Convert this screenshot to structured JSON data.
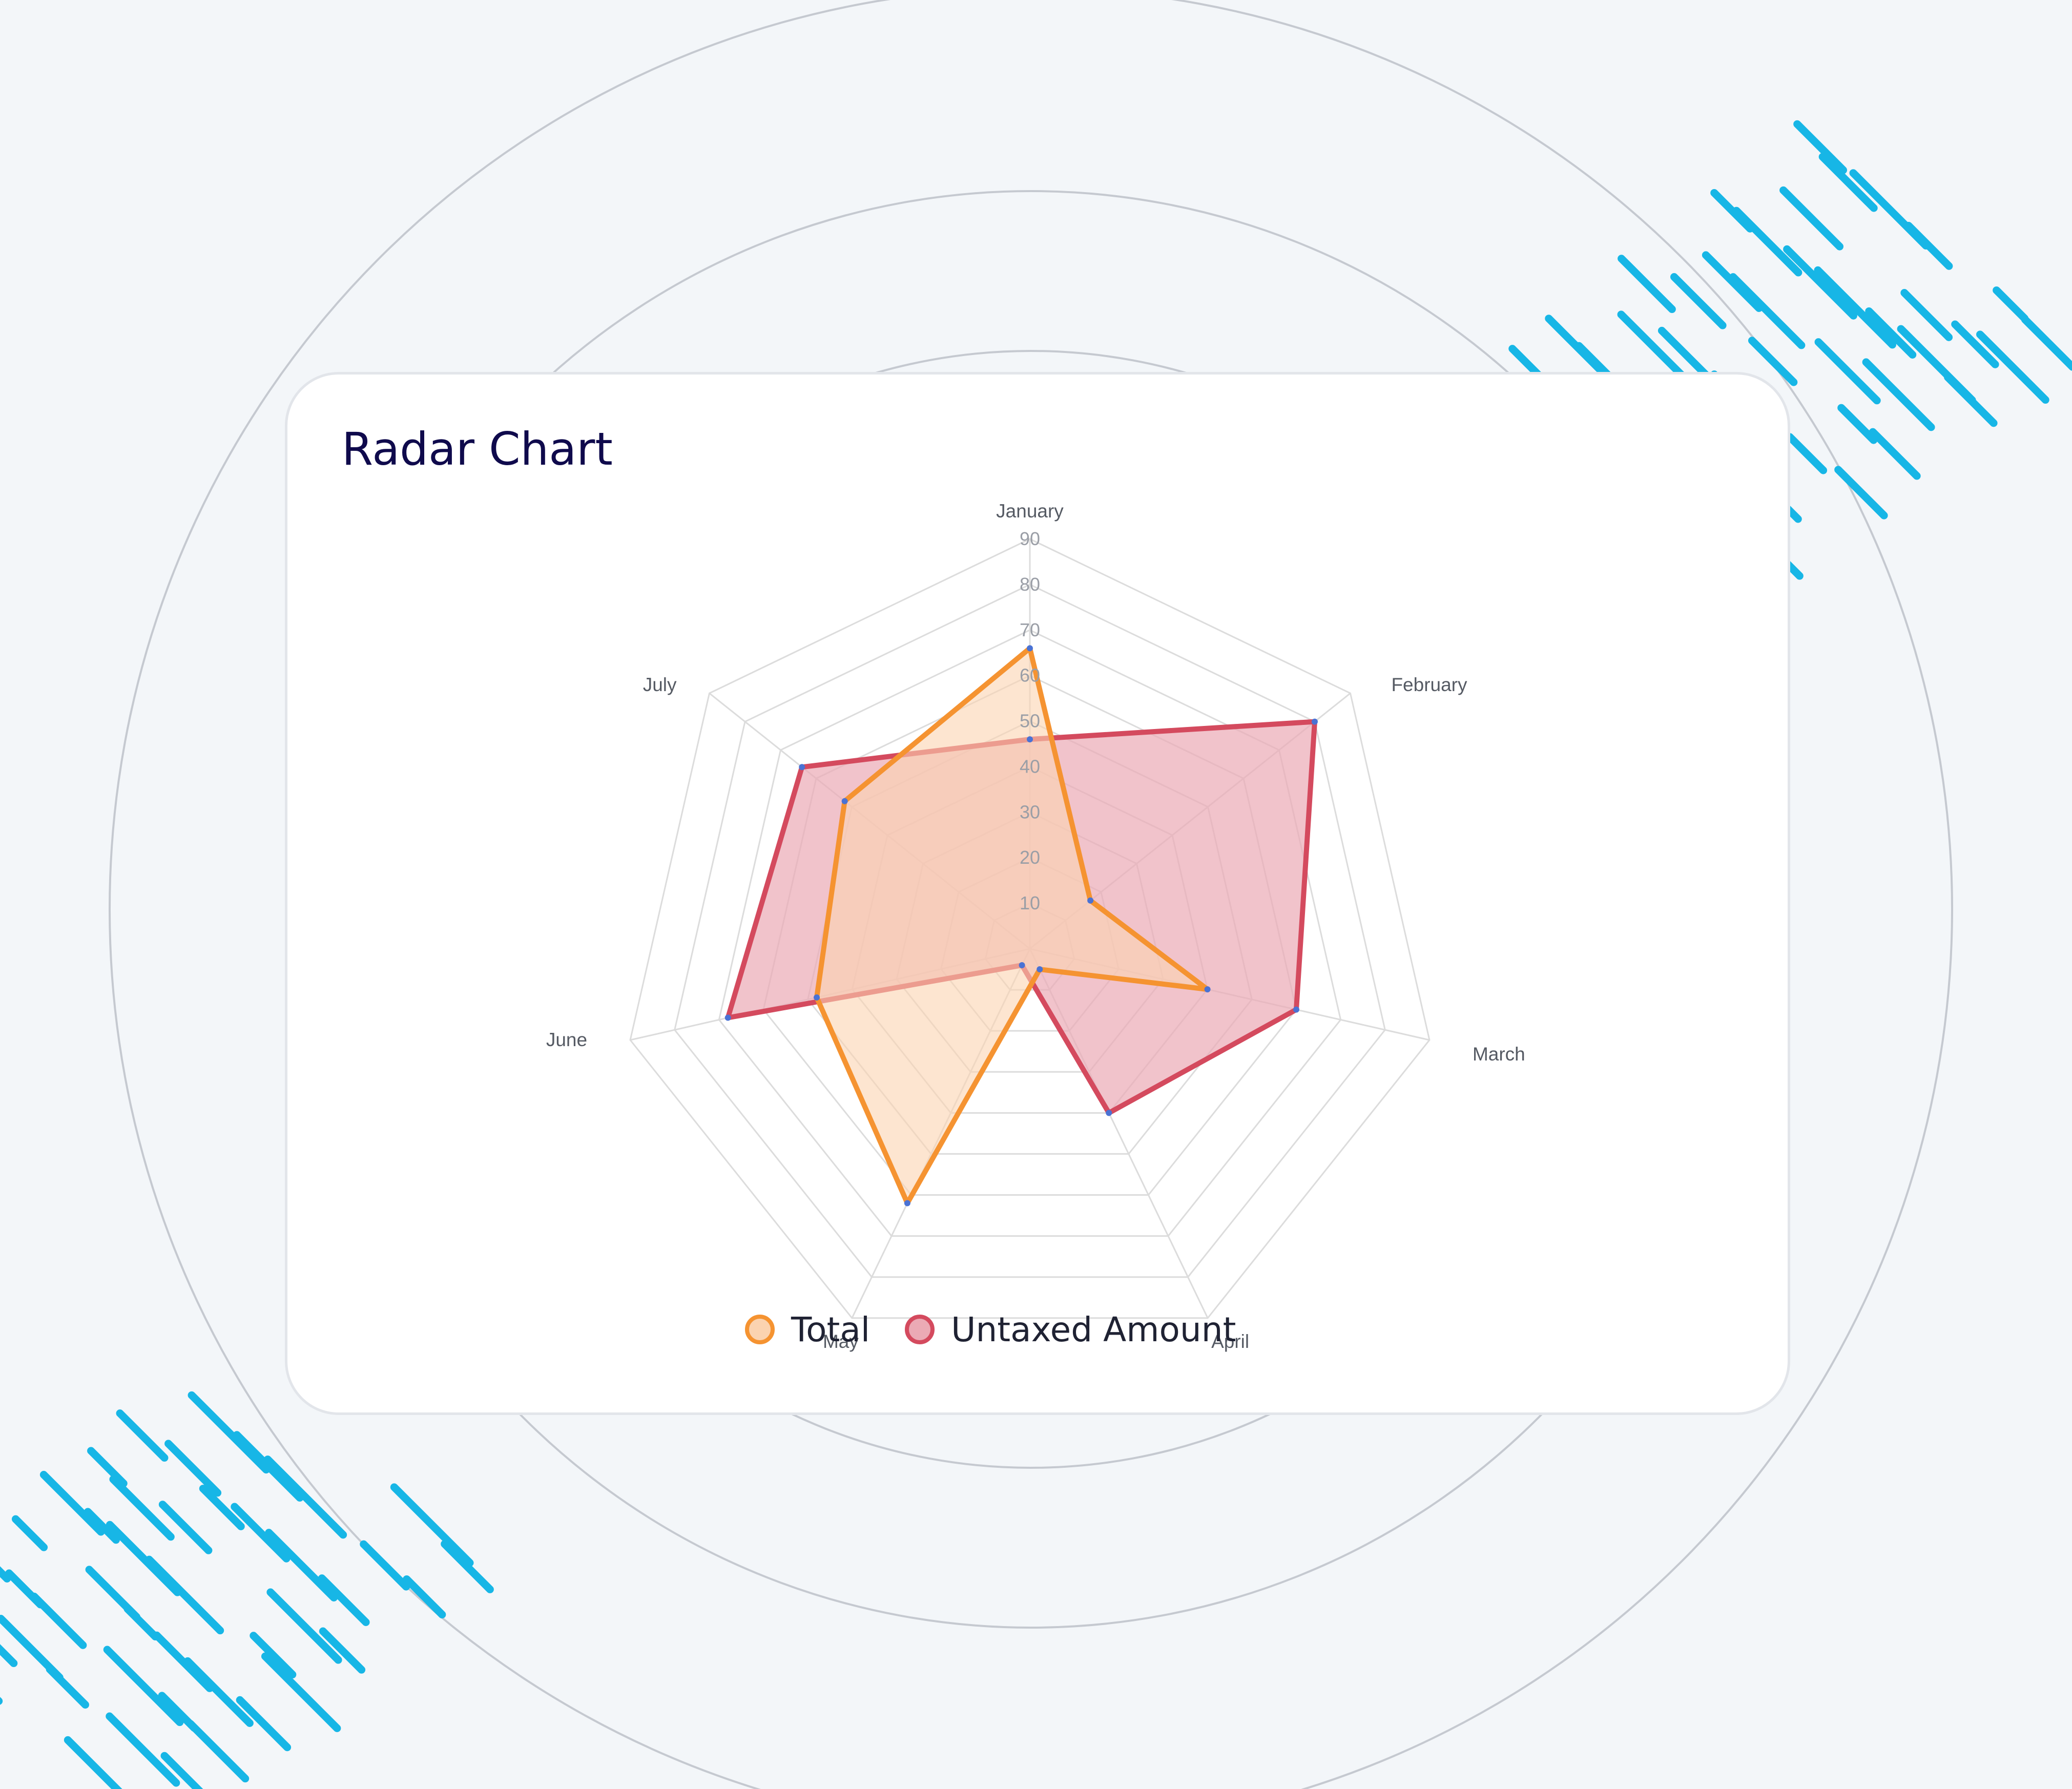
{
  "card": {
    "title": "Radar Chart"
  },
  "colors": {
    "background": "#f3f6f9",
    "ring": "#c5c9d0",
    "dash": "#17b6e6",
    "grid": "#dcdcdc",
    "title": "#0f0a4c",
    "total_stroke": "#f59331",
    "total_fill": "#fbd3b0",
    "untaxed_stroke": "#d44a5e",
    "untaxed_fill": "#ebaab5",
    "point": "#4a72d4"
  },
  "legend": {
    "items": [
      {
        "label": "Total",
        "series": "total"
      },
      {
        "label": "Untaxed Amount",
        "series": "untaxed"
      }
    ]
  },
  "chart_data": {
    "type": "radar",
    "categories": [
      "January",
      "February",
      "March",
      "April",
      "May",
      "June",
      "July"
    ],
    "r_ticks": [
      "10",
      "20",
      "30",
      "40",
      "50",
      "60",
      "70",
      "80",
      "90"
    ],
    "r_range": [
      0,
      90
    ],
    "grid": true,
    "legend_position": "bottom",
    "series": [
      {
        "name": "Total",
        "key": "total",
        "values": [
          66,
          17,
          40,
          5,
          62,
          48,
          52
        ]
      },
      {
        "name": "Untaxed Amount",
        "key": "untaxed",
        "values": [
          46,
          80,
          60,
          40,
          4,
          68,
          64
        ]
      }
    ]
  }
}
